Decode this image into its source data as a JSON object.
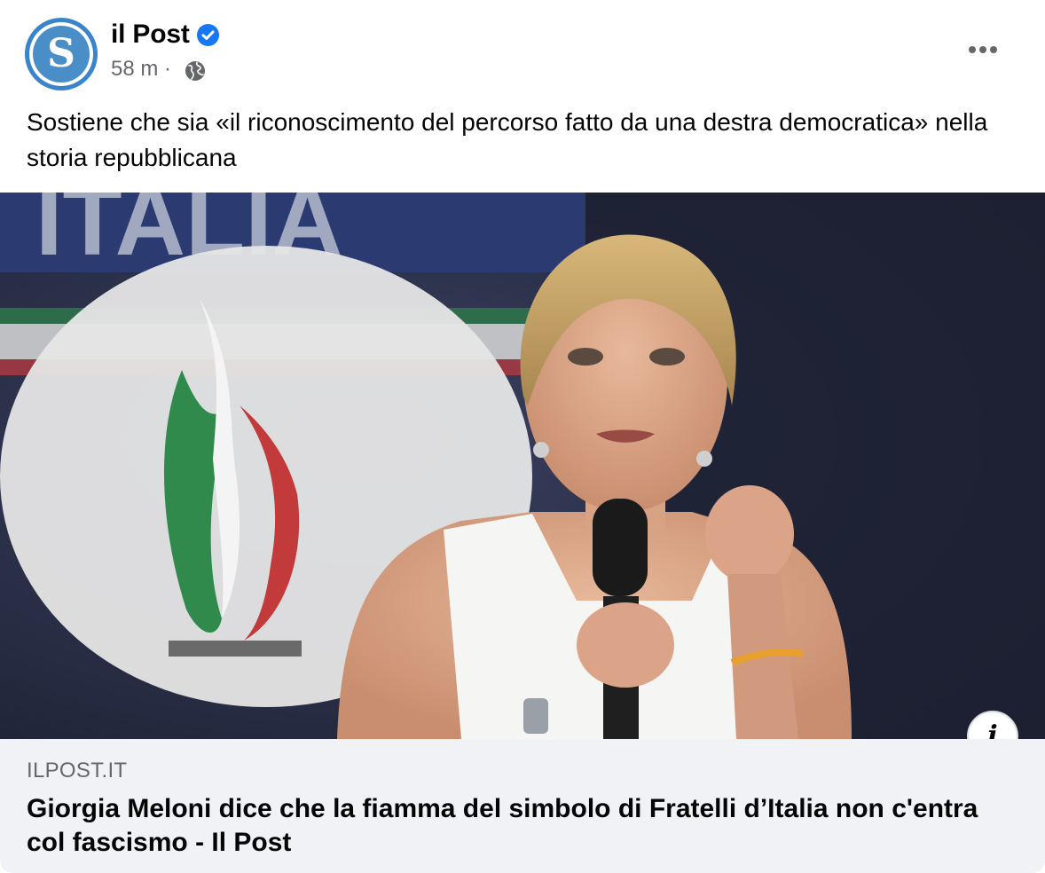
{
  "post": {
    "page_name": "il Post",
    "avatar_letter": "S",
    "timestamp": "58 m",
    "separator": "·",
    "verified_icon": "verified-badge-icon",
    "audience_icon": "globe-icon",
    "more_icon": "more-options-icon",
    "text": "Sostiene che sia «il riconoscimento del percorso fatto da una destra democratica» nella storia repubblicana"
  },
  "link_preview": {
    "domain": "ILPOST.IT",
    "title": "Giorgia Meloni dice che la fiamma del simbolo di Fratelli d’Italia non c'entra col fascismo - Il Post",
    "info_label": "i"
  },
  "colors": {
    "verified": "#1877f2",
    "secondary_text": "#65676b",
    "preview_bg": "#f0f2f5"
  }
}
